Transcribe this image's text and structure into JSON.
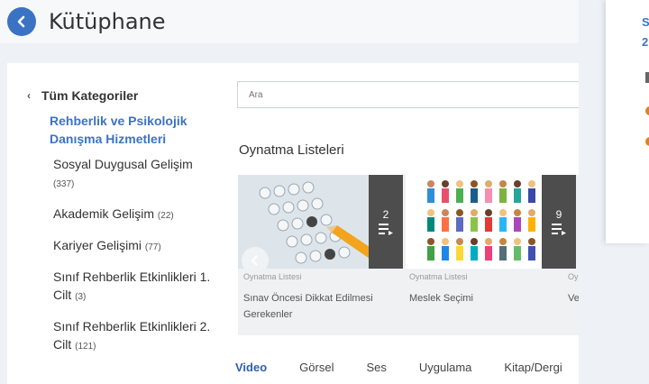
{
  "header": {
    "title": "Kütüphane"
  },
  "sidebar": {
    "all_categories": "Tüm Kategoriler",
    "active_category": "Rehberlik ve Psikolojik Danışma Hizmetleri",
    "items": [
      {
        "label": "Sosyal Duygusal Gelişim",
        "count": "(337)"
      },
      {
        "label": "Akademik Gelişim",
        "count": "(22)"
      },
      {
        "label": "Kariyer Gelişimi",
        "count": "(77)"
      },
      {
        "label": "Sınıf Rehberlik Etkinlikleri 1. Cilt",
        "count": "(3)"
      },
      {
        "label": "Sınıf Rehberlik Etkinlikleri 2. Cilt",
        "count": "(121)"
      }
    ]
  },
  "search": {
    "placeholder": "Ara"
  },
  "playlists": {
    "section_title": "Oynatma Listeleri",
    "cards": [
      {
        "type": "Oynatma Listesi",
        "title": "Sınav Öncesi Dikkat Edilmesi Gerekenler",
        "count": "2"
      },
      {
        "type": "Oynatma Listesi",
        "title": "Meslek Seçimi",
        "count": "9"
      },
      {
        "type": "Oynatma Listesi",
        "title": "Verimli ders n"
      }
    ]
  },
  "tabs": [
    {
      "label": "Video",
      "active": true
    },
    {
      "label": "Görsel",
      "active": false
    },
    {
      "label": "Ses",
      "active": false
    },
    {
      "label": "Uygulama",
      "active": false
    },
    {
      "label": "Kitap/Dergi",
      "active": false
    }
  ],
  "right_panel": {
    "line1": "S",
    "line2": "2"
  },
  "colors": {
    "accent": "#3b73c4",
    "orange": "#e08020",
    "dark_overlay": "#4d4d4d"
  },
  "icons": [
    "chevron-left-icon",
    "playlist-icon"
  ]
}
